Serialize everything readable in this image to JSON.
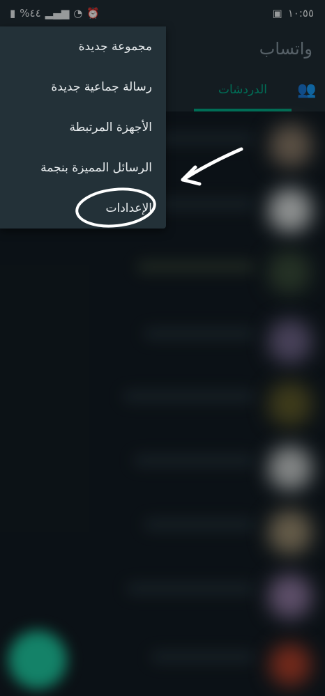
{
  "status_bar": {
    "time": "١٠:٥٥",
    "battery": "%٤٤"
  },
  "app": {
    "title": "واتساب"
  },
  "tabs": {
    "chats_label": "الدردشات"
  },
  "menu": {
    "items": [
      {
        "label": "مجموعة جديدة"
      },
      {
        "label": "رسالة جماعية جديدة"
      },
      {
        "label": "الأجهزة المرتبطة"
      },
      {
        "label": "الرسائل المميزة بنجمة"
      },
      {
        "label": "الإعدادات"
      }
    ]
  },
  "colors": {
    "accent": "#00a884",
    "header_bg": "#1f2c34",
    "menu_bg": "#233138",
    "background": "#121b22",
    "annotation": "#ffffff"
  }
}
